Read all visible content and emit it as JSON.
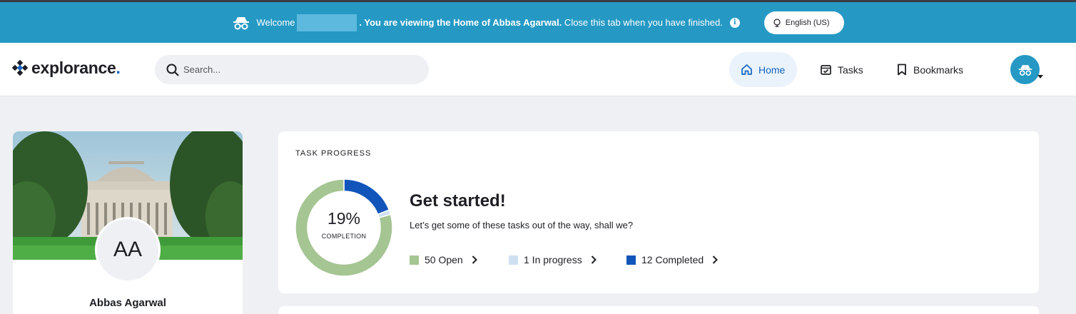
{
  "banner": {
    "welcome": "Welcome",
    "viewing_bold": ". You are viewing the Home of Abbas Agarwal.",
    "viewing_rest": " Close this tab when you have finished.",
    "info_glyph": "i",
    "language": "English (US)",
    "bg_color": "#2599c4"
  },
  "nav": {
    "logo_text": "explorance",
    "logo_dot": ".",
    "search_placeholder": "Search...",
    "home_label": "Home",
    "tasks_label": "Tasks",
    "bookmarks_label": "Bookmarks",
    "accent_color": "#1565c0"
  },
  "profile": {
    "initials": "AA",
    "name": "Abbas Agarwal"
  },
  "task_progress": {
    "section_title": "TASK PROGRESS",
    "percent_text": "19%",
    "completion_label": "COMPLETION",
    "heading": "Get started!",
    "subtext": "Let’s get some of these tasks out of the way, shall we?",
    "legend": [
      {
        "label": "50 Open",
        "color": "#a5c593",
        "count": 50
      },
      {
        "label": "1 In progress",
        "color": "#cfe0f1",
        "count": 1
      },
      {
        "label": "12 Completed",
        "color": "#1155bb",
        "count": 12
      }
    ]
  }
}
